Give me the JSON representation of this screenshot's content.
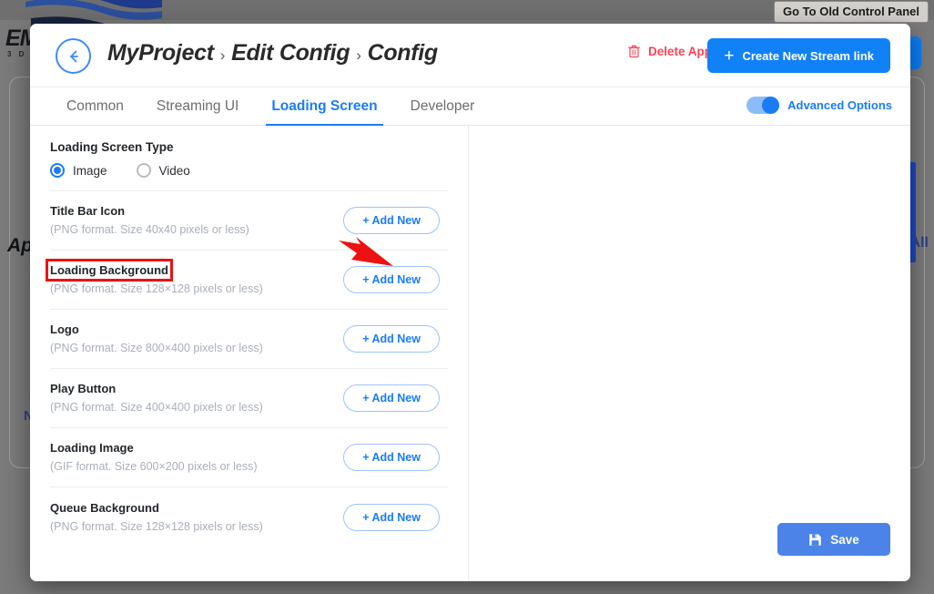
{
  "background": {
    "old_control_panel_button": "Go To Old Control Panel",
    "brand_text": "EM",
    "brand_sub": "3 D",
    "apps_label": "Ap",
    "all_label": "All",
    "new_app_label": "N",
    "accent_blue": "#1d47c4",
    "dim_color": "#7a7a7a"
  },
  "header": {
    "back_icon": "arrow-left-circle-icon",
    "breadcrumb": {
      "root": "MyProject",
      "sep1": "›",
      "mid": "Edit Config",
      "sep2": "›",
      "leaf": "Config"
    },
    "delete_app_label": "Delete App",
    "delete_icon": "trash-icon",
    "delete_color": "#ff4155",
    "create_stream_label": "Create New Stream link",
    "create_stream_plus": "+",
    "create_stream_color": "#1181f8"
  },
  "tabs": {
    "items": [
      {
        "label": "Common",
        "active": false
      },
      {
        "label": "Streaming UI",
        "active": false
      },
      {
        "label": "Loading Screen",
        "active": true
      },
      {
        "label": "Developer",
        "active": false
      }
    ],
    "advanced_options_label": "Advanced Options",
    "advanced_options_on": true,
    "active_color": "#1a7cf5"
  },
  "loading_screen": {
    "type_title": "Loading Screen Type",
    "type_options": [
      {
        "label": "Image",
        "selected": true
      },
      {
        "label": "Video",
        "selected": false
      }
    ],
    "add_new_label": "+ Add New",
    "assets": [
      {
        "name": "Title Bar Icon",
        "hint": "(PNG format. Size 40x40 pixels or less)",
        "highlighted": false
      },
      {
        "name": "Loading Background",
        "hint": "(PNG format. Size 128×128 pixels or less)",
        "highlighted": true
      },
      {
        "name": "Logo",
        "hint": "(PNG format. Size 800×400 pixels or less)",
        "highlighted": false
      },
      {
        "name": "Play Button",
        "hint": "(PNG format. Size 400×400 pixels or less)",
        "highlighted": false
      },
      {
        "name": "Loading Image",
        "hint": "(GIF format. Size 600×200 pixels or less)",
        "highlighted": false
      },
      {
        "name": "Queue Background",
        "hint": "(PNG format. Size 128×128 pixels or less)",
        "highlighted": false
      }
    ]
  },
  "footer": {
    "save_label": "Save",
    "save_icon": "floppy-disk-icon",
    "save_color": "#4b83e8"
  },
  "annotation": {
    "arrow_color": "#ee1111",
    "box_color": "#ee1111",
    "target": "Loading Background + Add New"
  }
}
